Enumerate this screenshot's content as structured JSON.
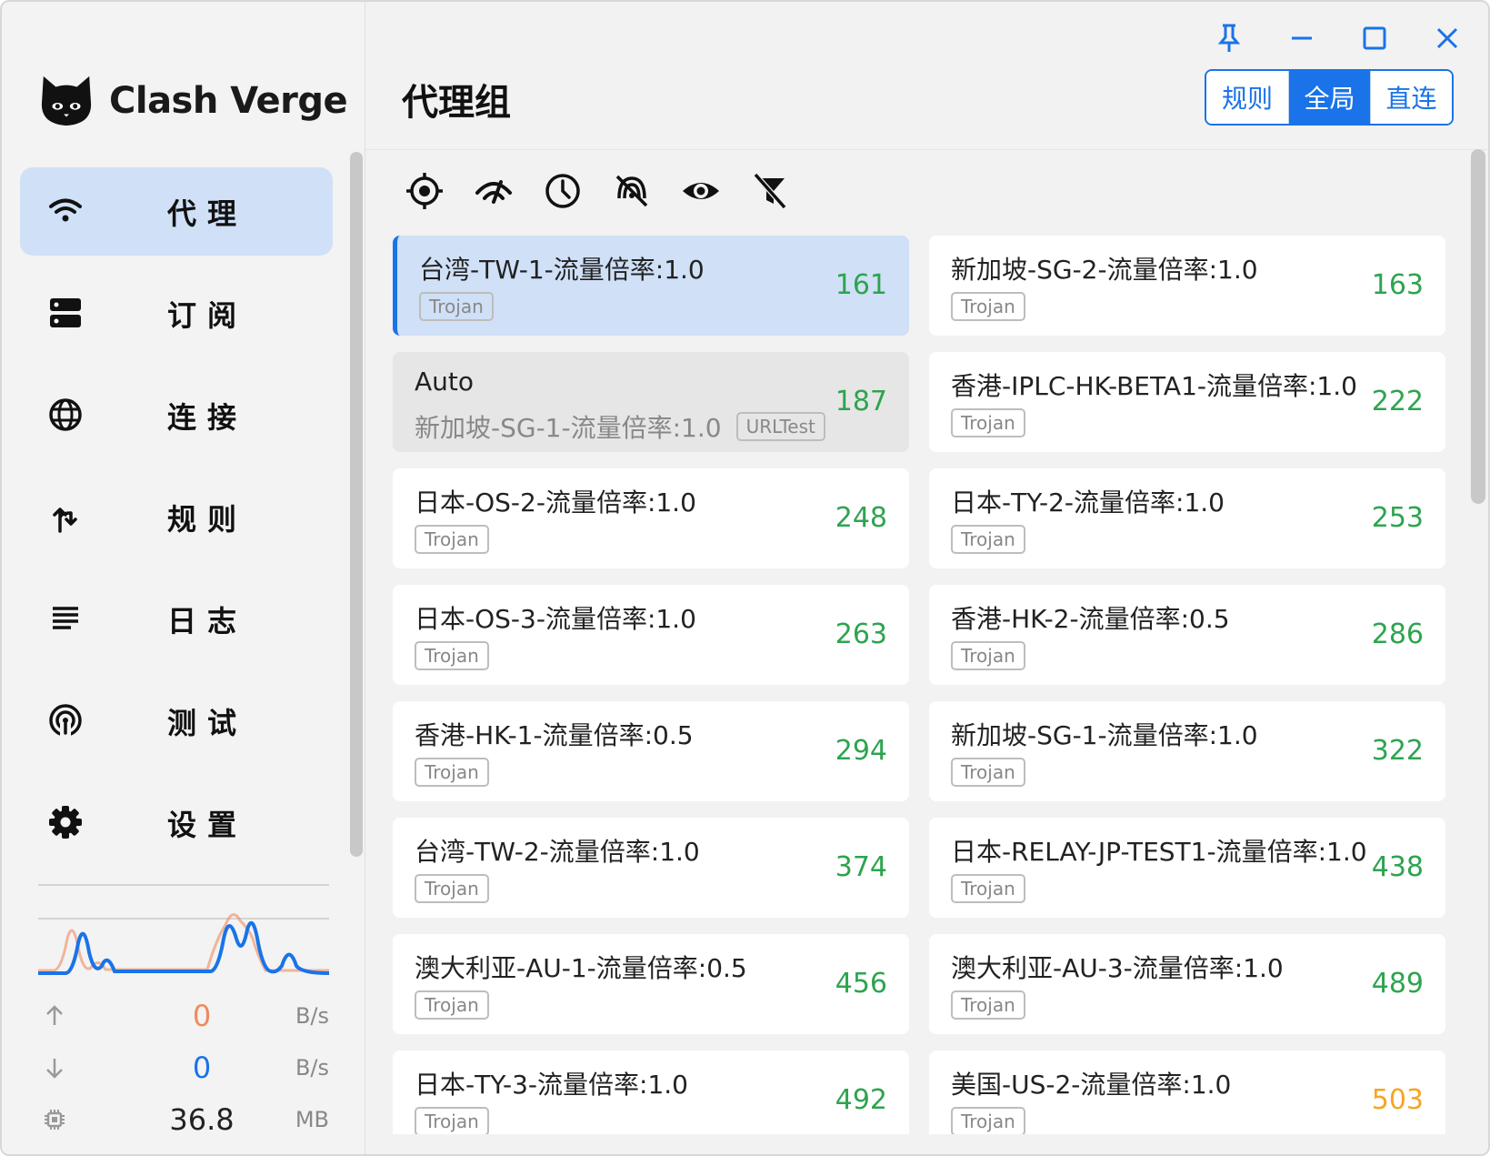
{
  "app": {
    "name": "Clash Verge"
  },
  "sidebar": {
    "items": [
      {
        "label": "代理",
        "icon": "wifi-icon",
        "active": true
      },
      {
        "label": "订阅",
        "icon": "server-icon",
        "active": false
      },
      {
        "label": "连接",
        "icon": "globe-icon",
        "active": false
      },
      {
        "label": "规则",
        "icon": "fork-arrow-icon",
        "active": false
      },
      {
        "label": "日志",
        "icon": "list-icon",
        "active": false
      },
      {
        "label": "测试",
        "icon": "broadcast-icon",
        "active": false
      },
      {
        "label": "设置",
        "icon": "gear-icon",
        "active": false
      }
    ],
    "traffic": {
      "upload": "0",
      "upload_unit": "B/s",
      "download": "0",
      "download_unit": "B/s",
      "memory": "36.8",
      "memory_unit": "MB"
    }
  },
  "header": {
    "title": "代理组",
    "modes": [
      "规则",
      "全局",
      "直连"
    ],
    "active_mode": "全局"
  },
  "toolbar": {
    "icons": [
      "locate-icon",
      "speed-test-icon",
      "clock-icon",
      "hide-signal-icon",
      "eye-icon",
      "filter-off-icon"
    ]
  },
  "proxies": [
    {
      "name": "台湾-TW-1-流量倍率:1.0",
      "type": "Trojan",
      "delay": "161"
    },
    {
      "name": "新加坡-SG-2-流量倍率:1.0",
      "type": "Trojan",
      "delay": "163"
    },
    {
      "name": "Auto",
      "sub": "新加坡-SG-1-流量倍率:1.0",
      "type": "URLTest",
      "delay": "187"
    },
    {
      "name": "香港-IPLC-HK-BETA1-流量倍率:1.0",
      "type": "Trojan",
      "delay": "222"
    },
    {
      "name": "日本-OS-2-流量倍率:1.0",
      "type": "Trojan",
      "delay": "248"
    },
    {
      "name": "日本-TY-2-流量倍率:1.0",
      "type": "Trojan",
      "delay": "253"
    },
    {
      "name": "日本-OS-3-流量倍率:1.0",
      "type": "Trojan",
      "delay": "263"
    },
    {
      "name": "香港-HK-2-流量倍率:0.5",
      "type": "Trojan",
      "delay": "286"
    },
    {
      "name": "香港-HK-1-流量倍率:0.5",
      "type": "Trojan",
      "delay": "294"
    },
    {
      "name": "新加坡-SG-1-流量倍率:1.0",
      "type": "Trojan",
      "delay": "322"
    },
    {
      "name": "台湾-TW-2-流量倍率:1.0",
      "type": "Trojan",
      "delay": "374"
    },
    {
      "name": "日本-RELAY-JP-TEST1-流量倍率:1.0",
      "type": "Trojan",
      "delay": "438"
    },
    {
      "name": "澳大利亚-AU-1-流量倍率:0.5",
      "type": "Trojan",
      "delay": "456"
    },
    {
      "name": "澳大利亚-AU-3-流量倍率:1.0",
      "type": "Trojan",
      "delay": "489"
    },
    {
      "name": "日本-TY-3-流量倍率:1.0",
      "type": "Trojan",
      "delay": "492"
    },
    {
      "name": "美国-US-2-流量倍率:1.0",
      "type": "Trojan",
      "delay": "503"
    }
  ],
  "colors": {
    "accent": "#1a73e8",
    "delay_good": "#2ea44f",
    "delay_warn": "#f5a623",
    "upload": "#f08a5d",
    "download": "#1a73e8"
  }
}
